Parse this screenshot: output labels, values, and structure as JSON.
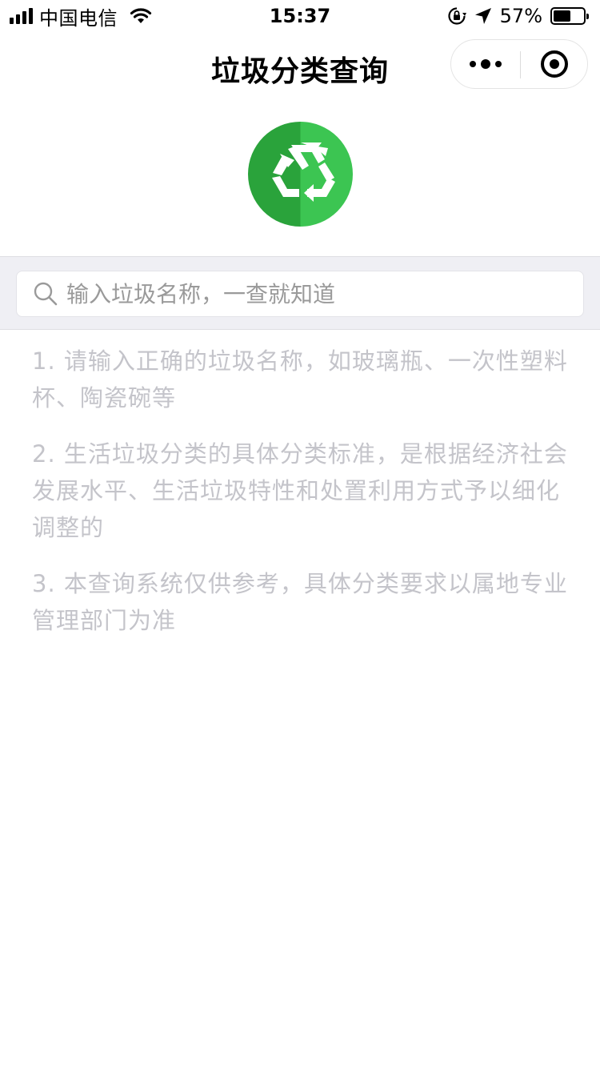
{
  "status_bar": {
    "carrier": "中国电信",
    "time": "15:37",
    "battery_percent_label": "57%",
    "battery_level": 0.57,
    "signal_icon": "signal-bars-icon",
    "wifi_icon": "wifi-icon",
    "lock_icon": "orientation-lock-icon",
    "location_icon": "location-arrow-icon"
  },
  "nav": {
    "title": "垃圾分类查询",
    "more_icon": "more-dots-icon",
    "close_icon": "target-close-icon"
  },
  "logo": {
    "icon": "recycle-icon",
    "color_dark": "#2aa33b",
    "color_light": "#3cc552"
  },
  "search": {
    "placeholder": "输入垃圾名称，一查就知道",
    "value": "",
    "icon": "search-icon"
  },
  "tips": [
    "1. 请输入正确的垃圾名称，如玻璃瓶、一次性塑料杯、陶瓷碗等",
    "2. 生活垃圾分类的具体分类标准，是根据经济社会发展水平、生活垃圾特性和处置利用方式予以细化调整的",
    "3. 本查询系统仅供参考，具体分类要求以属地专业管理部门为准"
  ],
  "colors": {
    "tip_text": "#c4c4ca",
    "search_bg": "#efeff4"
  }
}
